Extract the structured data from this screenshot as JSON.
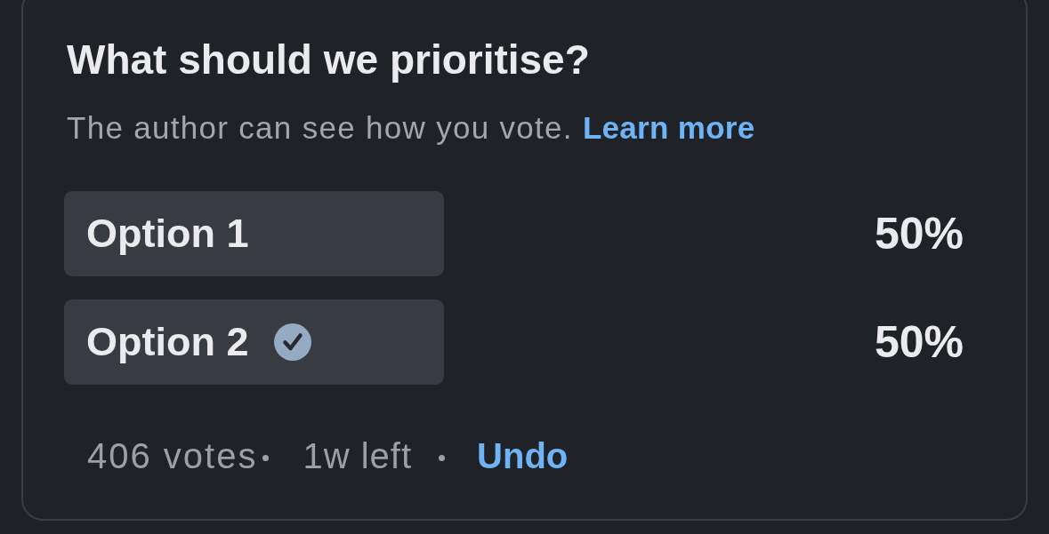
{
  "poll": {
    "question": "What should we prioritise?",
    "notice": "The author can see how you vote.",
    "learn_more": "Learn more",
    "options": [
      {
        "label": "Option 1",
        "percent": "50%",
        "selected": false
      },
      {
        "label": "Option 2",
        "percent": "50%",
        "selected": true
      }
    ],
    "footer": {
      "votes": "406 votes",
      "time_left": "1w left",
      "undo": "Undo"
    }
  }
}
